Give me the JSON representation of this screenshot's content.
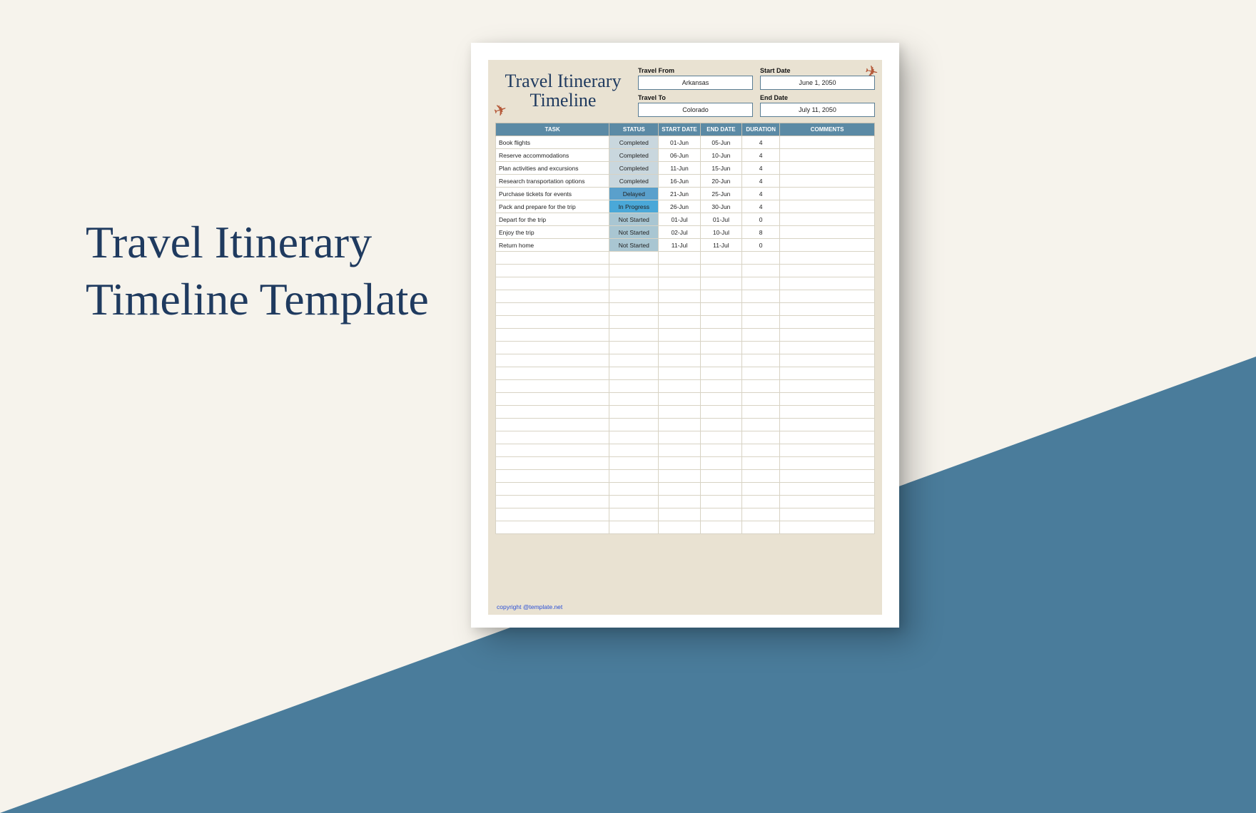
{
  "headline": {
    "line1": "Travel Itinerary",
    "line2": "Timeline Template"
  },
  "doc": {
    "title_line1": "Travel Itinerary",
    "title_line2": "Timeline",
    "fields": {
      "travel_from": {
        "label": "Travel From",
        "value": "Arkansas"
      },
      "start_date": {
        "label": "Start Date",
        "value": "June 1, 2050"
      },
      "travel_to": {
        "label": "Travel To",
        "value": "Colorado"
      },
      "end_date": {
        "label": "End Date",
        "value": "July 11, 2050"
      }
    },
    "columns": {
      "task": "TASK",
      "status": "STATUS",
      "start_date": "START DATE",
      "end_date": "END DATE",
      "duration": "DURATION",
      "comments": "COMMENTS"
    },
    "rows": [
      {
        "task": "Book flights",
        "status": "Completed",
        "status_class": "st-completed",
        "start": "01-Jun",
        "end": "05-Jun",
        "duration": "4",
        "comments": ""
      },
      {
        "task": "Reserve accommodations",
        "status": "Completed",
        "status_class": "st-completed",
        "start": "06-Jun",
        "end": "10-Jun",
        "duration": "4",
        "comments": ""
      },
      {
        "task": "Plan activities and excursions",
        "status": "Completed",
        "status_class": "st-completed",
        "start": "11-Jun",
        "end": "15-Jun",
        "duration": "4",
        "comments": ""
      },
      {
        "task": "Research transportation options",
        "status": "Completed",
        "status_class": "st-completed",
        "start": "16-Jun",
        "end": "20-Jun",
        "duration": "4",
        "comments": ""
      },
      {
        "task": "Purchase tickets for events",
        "status": "Delayed",
        "status_class": "st-delayed",
        "start": "21-Jun",
        "end": "25-Jun",
        "duration": "4",
        "comments": ""
      },
      {
        "task": "Pack and prepare for the trip",
        "status": "In Progress",
        "status_class": "st-inprogress",
        "start": "26-Jun",
        "end": "30-Jun",
        "duration": "4",
        "comments": ""
      },
      {
        "task": "Depart for the trip",
        "status": "Not Started",
        "status_class": "st-notstarted",
        "start": "01-Jul",
        "end": "01-Jul",
        "duration": "0",
        "comments": ""
      },
      {
        "task": "Enjoy the trip",
        "status": "Not Started",
        "status_class": "st-notstarted",
        "start": "02-Jul",
        "end": "10-Jul",
        "duration": "8",
        "comments": ""
      },
      {
        "task": "Return home",
        "status": "Not Started",
        "status_class": "st-notstarted",
        "start": "11-Jul",
        "end": "11-Jul",
        "duration": "0",
        "comments": ""
      }
    ],
    "empty_row_count": 22,
    "copyright": "copyright @template.net"
  }
}
